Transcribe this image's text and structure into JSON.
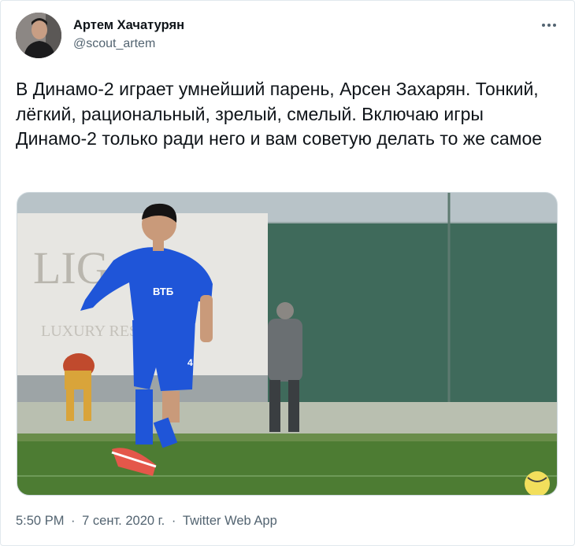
{
  "author": {
    "name": "Артем Хачатурян",
    "handle": "@scout_artem"
  },
  "tweet": {
    "text": "В Динамо-2 играет умнейший парень, Арсен Захарян. Тонкий, лёгкий, рациональный, зрелый, смелый. Включаю игры Динамо-2 только ради него и вам советую делать то же самое"
  },
  "media": {
    "banner_text": "LIG A",
    "banner_subtext": "LUXURY RESORT",
    "kit_text": "ВТБ",
    "shirt_number": "4"
  },
  "meta": {
    "time": "5:50 PM",
    "date": "7 сент. 2020 г.",
    "separator": "·",
    "source": "Twitter Web App"
  },
  "icons": {
    "more": "more-horizontal-icon"
  },
  "colors": {
    "text_primary": "#0f1419",
    "text_secondary": "#536471",
    "border": "#e1e8ed",
    "kit_blue": "#1d4ed8"
  }
}
